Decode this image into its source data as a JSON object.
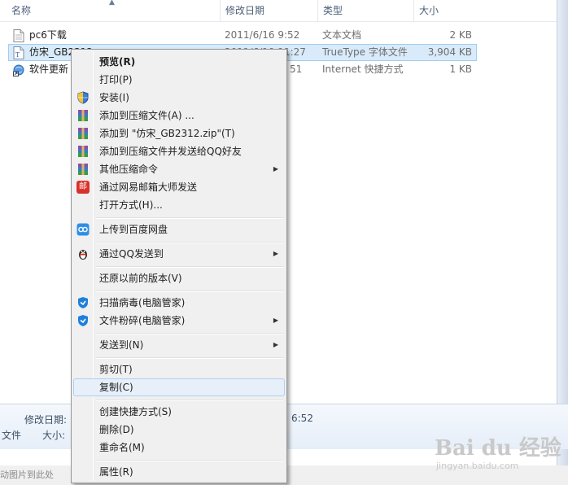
{
  "columns": {
    "name": "名称",
    "date": "修改日期",
    "type": "类型",
    "size": "大小"
  },
  "files": [
    {
      "name": "pc6下载",
      "date": "2011/6/16 9:52",
      "type": "文本文档",
      "size": "2 KB",
      "icon": "text-document-icon"
    },
    {
      "name": "仿宋_GB2312",
      "date": "2011/6/10 11:27",
      "type": "TrueType 字体文件",
      "size": "3,904 KB",
      "icon": "font-file-icon"
    },
    {
      "name": "软件更新",
      "date": "51",
      "type": "Internet 快捷方式",
      "size": "1 KB",
      "icon": "internet-shortcut-icon"
    }
  ],
  "details": {
    "modified_label": "修改日期:",
    "modified_value": "6:52",
    "size_label": "大小:",
    "left_fragment": "文件"
  },
  "statusbar": {
    "text": "动图片到此处"
  },
  "watermark": {
    "big": "Bai du 经验",
    "small": "jingyan.baidu.com"
  },
  "context_menu": {
    "items": [
      {
        "label": "预览(R)",
        "bold": true
      },
      {
        "label": "打印(P)"
      },
      {
        "label": "安装(I)",
        "icon": "shield-icon"
      },
      {
        "label": "添加到压缩文件(A) ...",
        "icon": "winrar-icon"
      },
      {
        "label": "添加到 \"仿宋_GB2312.zip\"(T)",
        "icon": "winrar-icon"
      },
      {
        "label": "添加到压缩文件并发送给QQ好友",
        "icon": "winrar-icon"
      },
      {
        "label": "其他压缩命令",
        "icon": "winrar-icon",
        "submenu": true
      },
      {
        "label": "通过网易邮箱大师发送",
        "icon": "netease-mail-icon",
        "icon_text": "邮"
      },
      {
        "label": "打开方式(H)..."
      },
      {
        "label": "上传到百度网盘",
        "icon": "baidu-netdisk-icon"
      },
      {
        "label": "通过QQ发送到",
        "icon": "qq-penguin-icon",
        "submenu": true
      },
      {
        "label": "还原以前的版本(V)"
      },
      {
        "label": "扫描病毒(电脑管家)",
        "icon": "tencent-pc-manager-icon"
      },
      {
        "label": "文件粉碎(电脑管家)",
        "icon": "tencent-pc-manager-icon",
        "submenu": true
      },
      {
        "label": "发送到(N)",
        "submenu": true
      },
      {
        "label": "剪切(T)"
      },
      {
        "label": "复制(C)",
        "hovered": true
      },
      {
        "label": "创建快捷方式(S)"
      },
      {
        "label": "删除(D)"
      },
      {
        "label": "重命名(M)"
      },
      {
        "label": "属性(R)"
      }
    ]
  },
  "colors": {
    "selection_bg": "#d9ebfb",
    "menu_bg": "#f0f0f0",
    "hover_bg": "#e7eff8"
  }
}
